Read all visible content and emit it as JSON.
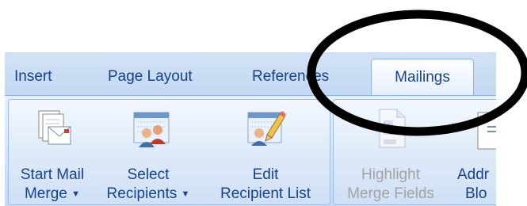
{
  "tabs": {
    "insert": "Insert",
    "page_layout": "Page Layout",
    "references": "References",
    "mailings": "Mailings"
  },
  "buttons": {
    "start_mail_merge": {
      "line1": "Start Mail",
      "line2": "Merge",
      "icon": "document-envelope-icon"
    },
    "select_recipients": {
      "line1": "Select",
      "line2": "Recipients",
      "icon": "address-book-people-icon"
    },
    "edit_recipient_list": {
      "line1": "Edit",
      "line2": "Recipient List",
      "icon": "address-book-pencil-icon"
    },
    "highlight_merge_fields": {
      "line1": "Highlight",
      "line2": "Merge Fields",
      "icon": "document-fields-icon"
    },
    "address_block": {
      "line1": "Addr",
      "line2": "Blo",
      "icon": "address-block-icon"
    }
  },
  "colors": {
    "label_text": "#15428b",
    "disabled_text": "#a3a3a3",
    "ribbon_background": "#dbe7f7",
    "annotation_circle": "#000000"
  }
}
